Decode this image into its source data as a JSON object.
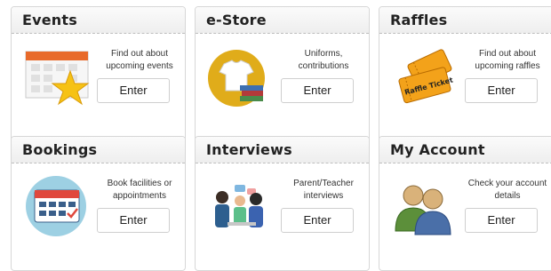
{
  "cards": [
    {
      "title": "Events",
      "description": "Find out about upcoming events",
      "button": "Enter",
      "icon": "calendar-star-icon"
    },
    {
      "title": "e-Store",
      "description": "Uniforms, contributions",
      "button": "Enter",
      "icon": "tshirt-books-icon"
    },
    {
      "title": "Raffles",
      "description": "Find out about upcoming raffles",
      "button": "Enter",
      "icon": "raffle-ticket-icon"
    },
    {
      "title": "Bookings",
      "description": "Book facilities or appointments",
      "button": "Enter",
      "icon": "booking-calendar-icon"
    },
    {
      "title": "Interviews",
      "description": "Parent/Teacher interviews",
      "button": "Enter",
      "icon": "interview-people-icon"
    },
    {
      "title": "My Account",
      "description": "Check your account details",
      "button": "Enter",
      "icon": "account-users-icon"
    }
  ],
  "raffle_ticket_text": "Raffle Ticket",
  "colors": {
    "ticket": "#f3a21a",
    "tshirt_circle": "#e0ac1a",
    "booking_circle": "#9dd0e3"
  }
}
